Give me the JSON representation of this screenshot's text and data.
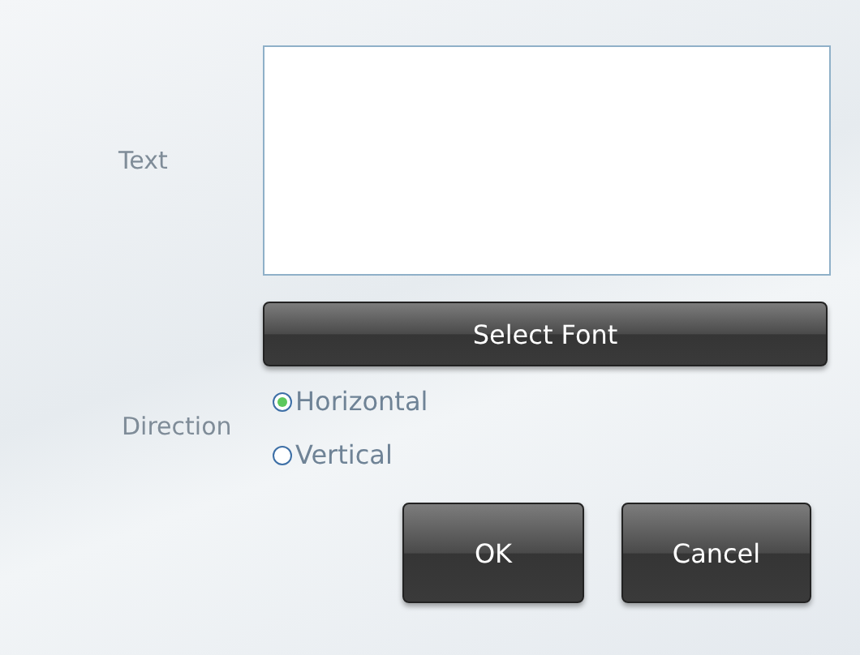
{
  "text_field": {
    "label": "Text"
  },
  "select_font_button": "Select Font",
  "direction": {
    "label": "Direction",
    "options": [
      {
        "label": "Horizontal",
        "selected": true
      },
      {
        "label": "Vertical",
        "selected": false
      }
    ]
  },
  "buttons": [
    "OK",
    "Cancel"
  ]
}
